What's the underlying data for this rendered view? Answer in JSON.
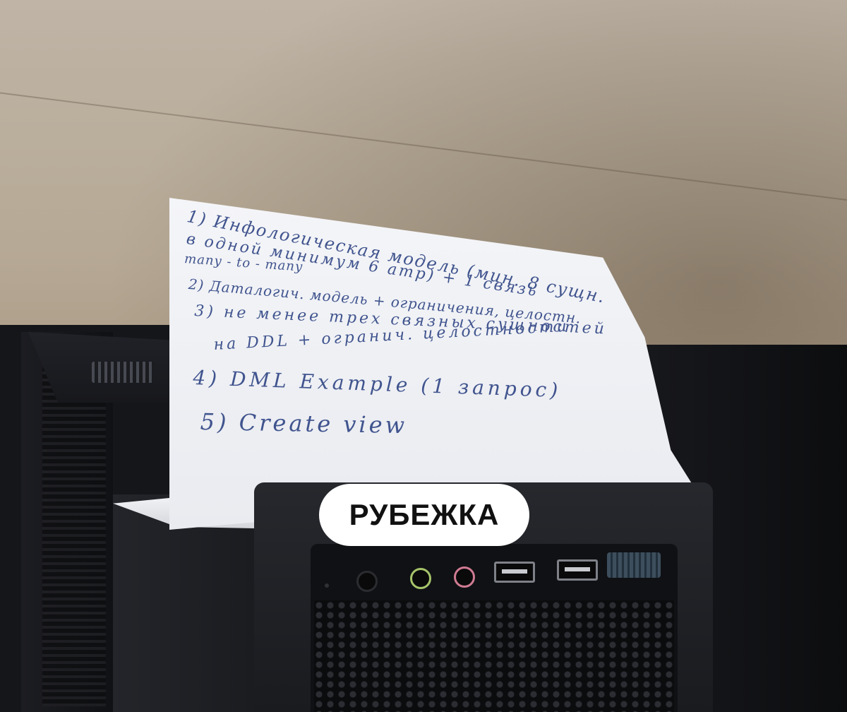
{
  "note": {
    "lines": [
      "1) Инфологическая модель (мин. 8 сущн.",
      "в одной минимум 6 атр) + 1 связь",
      "many - to - many",
      "2) Даталогич. модель + ограничения, целостн.",
      "3) не менее трех связных сущностей",
      "на DDL + огранич. целостности",
      "4) DML Example (1 запрос)",
      "5) Create view"
    ],
    "ink_color": "#40548e"
  },
  "caption": {
    "text": "РУБЕЖКА"
  }
}
